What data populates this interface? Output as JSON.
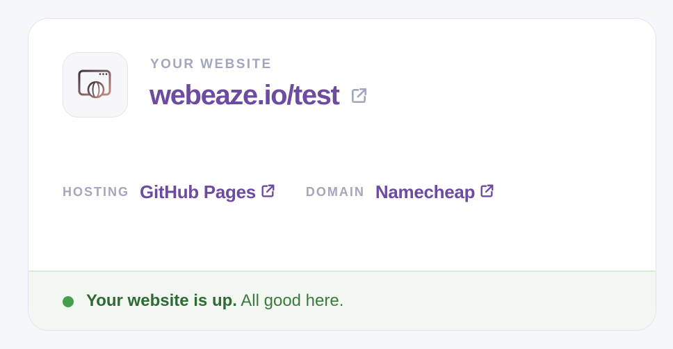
{
  "website": {
    "eyebrow": "YOUR WEBSITE",
    "url": "webeaze.io/test",
    "icon": "browser-globe-icon",
    "link_icon": "external-link-icon"
  },
  "hosting": {
    "label": "HOSTING",
    "value": "GitHub Pages",
    "icon": "external-link-icon"
  },
  "domain": {
    "label": "DOMAIN",
    "value": "Namecheap",
    "icon": "external-link-icon"
  },
  "status": {
    "headline": "Your website is up.",
    "detail": "All good here.",
    "state": "up"
  },
  "colors": {
    "accent": "#6c4ba1",
    "muted": "#a3a7bd",
    "success": "#44a04b",
    "success_text": "#2e6b34",
    "success_bg": "#f2f8f1"
  }
}
